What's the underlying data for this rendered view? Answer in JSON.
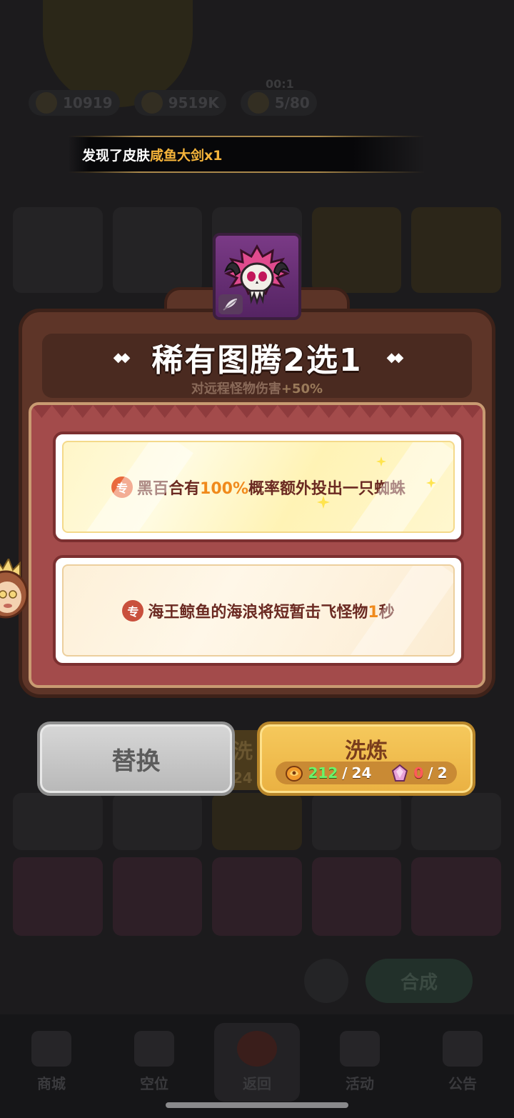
{
  "background": {
    "timer": "00:1",
    "resources": [
      {
        "name": "gem",
        "value": "10919"
      },
      {
        "name": "coin",
        "value": "9519K"
      },
      {
        "name": "stamina",
        "value": "5/80"
      }
    ],
    "merge_button": "合成",
    "nav": [
      {
        "label": "商城"
      },
      {
        "label": "空位"
      },
      {
        "label": "返回"
      },
      {
        "label": "活动"
      },
      {
        "label": "公告"
      }
    ],
    "refine_peek": "洗",
    "refine_peek_num": "24"
  },
  "banner": {
    "prefix": "发现了皮肤",
    "item": "咸鱼大剑x1"
  },
  "dialog": {
    "title": "稀有图腾2选1",
    "subtitle_prefix": "对远程怪物伤害",
    "subtitle_value": "+50%",
    "options": [
      {
        "badge": "专",
        "text_before": "黑百合有",
        "highlight": "100%",
        "text_after": "概率额外投出一只蜘蛛"
      },
      {
        "badge": "专",
        "text_before": "海王鲸鱼的海浪将短暂击飞怪物",
        "highlight": "1",
        "text_after": "秒"
      }
    ],
    "replace_button": "替换",
    "refine_button": "洗炼",
    "costs": [
      {
        "icon": "refine-stone-icon",
        "have": "212",
        "need": "24",
        "enough": true
      },
      {
        "icon": "crystal-icon",
        "have": "0",
        "need": "2",
        "enough": false
      }
    ]
  },
  "colors": {
    "highlight_gold": "#f5b43a",
    "highlight_orange": "#f08a1c",
    "panel_brown": "#5e3528",
    "content_red": "#a34b4b",
    "refine_gold": "#eab142"
  }
}
